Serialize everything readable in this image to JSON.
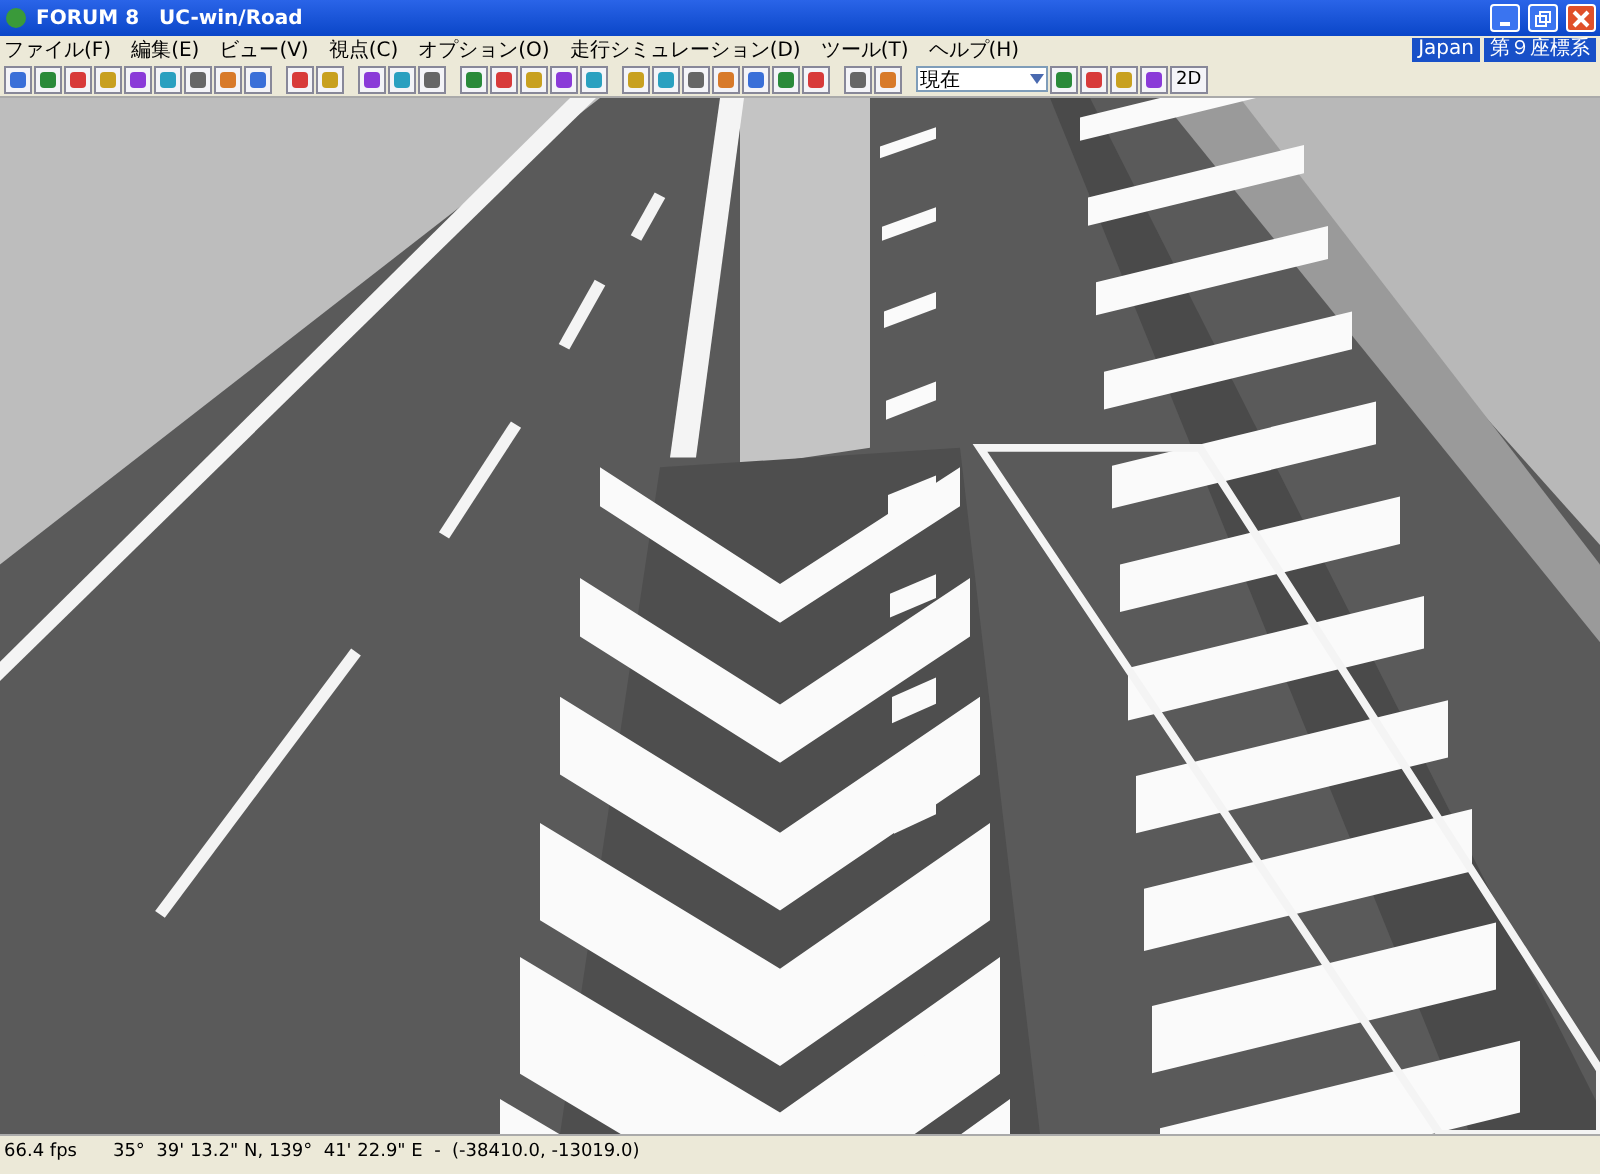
{
  "window": {
    "title": "FORUM 8　UC-win/Road"
  },
  "menu": [
    "ファイル(F)",
    "編集(E)",
    "ビュー(V)",
    "視点(C)",
    "オプション(O)",
    "走行シミュレーション(D)",
    "ツール(T)",
    "ヘルプ(H)"
  ],
  "region_badges": [
    "Japan",
    "第９座標系"
  ],
  "toolbar": {
    "viewpoint_dropdown": {
      "value": "現在"
    },
    "mode_button": "2D"
  },
  "status_bar": {
    "fps": "66.4 fps",
    "position": "35°  39' 13.2\" N, 139°  41' 22.9\" E  -  (-38410.0, -13019.0)"
  }
}
